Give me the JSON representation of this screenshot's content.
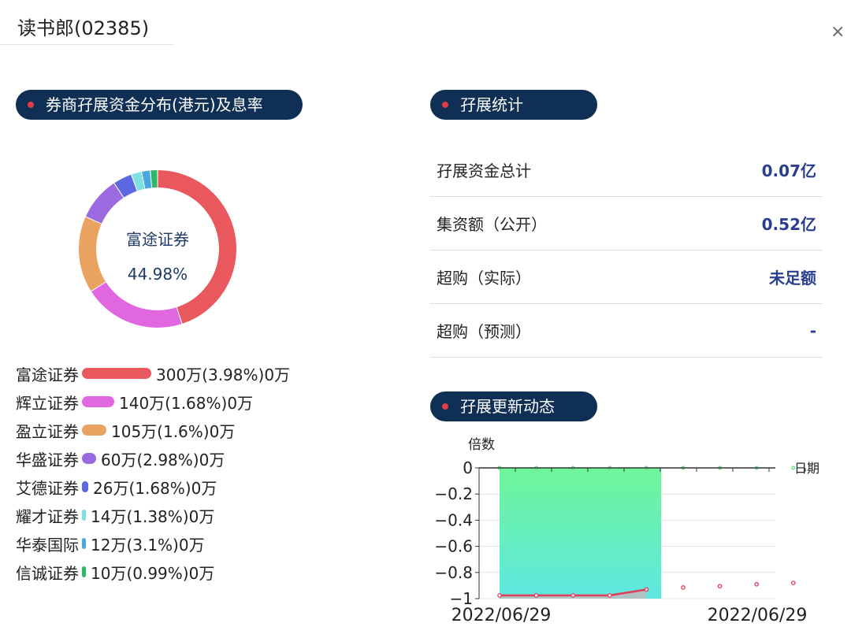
{
  "header": {
    "title": "读书郎(02385)",
    "close_label": "×"
  },
  "sections": {
    "distribution_title": "券商孖展资金分布(港元)及息率",
    "stats_title": "孖展统计",
    "updates_title": "孖展更新动态"
  },
  "donut": {
    "center_name": "富途证券",
    "center_pct": "44.98%",
    "segments": [
      {
        "name": "富途证券",
        "share": 44.98,
        "color": "#e9585c"
      },
      {
        "name": "辉立证券",
        "share": 20.99,
        "color": "#e067e0"
      },
      {
        "name": "盈立证券",
        "share": 15.74,
        "color": "#e9a260"
      },
      {
        "name": "华盛证券",
        "share": 9.0,
        "color": "#9b6ae0"
      },
      {
        "name": "艾德证券",
        "share": 3.9,
        "color": "#5c67e0"
      },
      {
        "name": "耀才证券",
        "share": 2.1,
        "color": "#7ee0e0"
      },
      {
        "name": "华泰国际",
        "share": 1.8,
        "color": "#4aa8e0"
      },
      {
        "name": "信诚证券",
        "share": 1.5,
        "color": "#2fb86a"
      }
    ]
  },
  "legend": [
    {
      "name": "富途证券",
      "detail": "300万(3.98%)0万",
      "amount": 300,
      "color": "#e9585c"
    },
    {
      "name": "辉立证券",
      "detail": "140万(1.68%)0万",
      "amount": 140,
      "color": "#e067e0"
    },
    {
      "name": "盈立证券",
      "detail": "105万(1.6%)0万",
      "amount": 105,
      "color": "#e9a260"
    },
    {
      "name": "华盛证券",
      "detail": "60万(2.98%)0万",
      "amount": 60,
      "color": "#9b6ae0"
    },
    {
      "name": "艾德证券",
      "detail": "26万(1.68%)0万",
      "amount": 26,
      "color": "#5c67e0"
    },
    {
      "name": "耀才证券",
      "detail": "14万(1.38%)0万",
      "amount": 14,
      "color": "#7ee0e0"
    },
    {
      "name": "华泰国际",
      "detail": "12万(3.1%)0万",
      "amount": 12,
      "color": "#4aa8e0"
    },
    {
      "name": "信诚证券",
      "detail": "10万(0.99%)0万",
      "amount": 10,
      "color": "#2fb86a"
    }
  ],
  "stats": [
    {
      "label": "孖展资金总计",
      "value": "0.07亿"
    },
    {
      "label": "集资额（公开）",
      "value": "0.52亿"
    },
    {
      "label": "超购（实际）",
      "value": "未足额"
    },
    {
      "label": "超购（预测）",
      "value": "-"
    }
  ],
  "chart_data": {
    "type": "line",
    "ylabel": "倍数",
    "xlabel": "日期",
    "ylim": [
      -1,
      0
    ],
    "yticks": [
      "0",
      "−0.2",
      "−0.4",
      "−0.6",
      "−0.8",
      "−1"
    ],
    "ytick_values": [
      0,
      -0.2,
      -0.4,
      -0.6,
      -0.8,
      -1
    ],
    "x_tick_labels": [
      "2022/06/29",
      "2022/06/29"
    ],
    "highlight_range": [
      0,
      4.4
    ],
    "series": [
      {
        "values": [
          -0.975,
          -0.975,
          -0.975,
          -0.975,
          -0.93,
          -0.915,
          -0.905,
          -0.89,
          -0.88
        ]
      }
    ],
    "colors": {
      "line": "#e23b5a",
      "band_top": "#6ef598",
      "band_bottom": "#5ee8e0",
      "top_points": "#5fd67f"
    }
  }
}
